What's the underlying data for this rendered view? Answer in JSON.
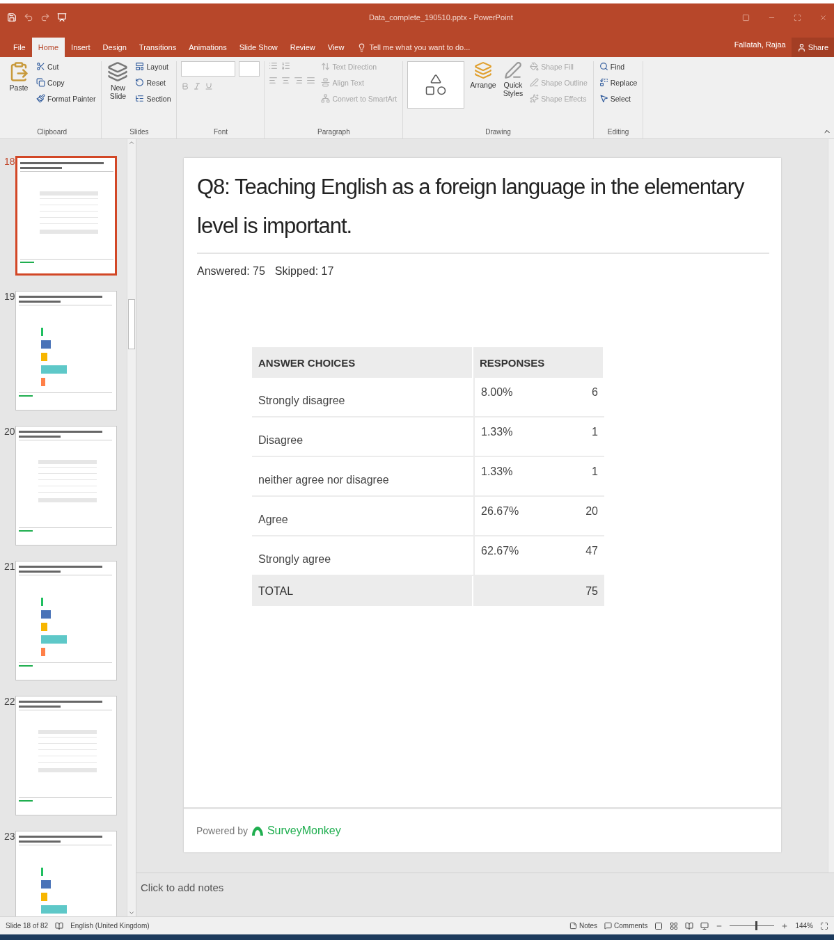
{
  "window": {
    "title": "Data_complete_190510.pptx - PowerPoint"
  },
  "tabs": [
    {
      "label": "File",
      "selected": false
    },
    {
      "label": "Home",
      "selected": true
    },
    {
      "label": "Insert",
      "selected": false
    },
    {
      "label": "Design",
      "selected": false
    },
    {
      "label": "Transitions",
      "selected": false
    },
    {
      "label": "Animations",
      "selected": false
    },
    {
      "label": "Slide Show",
      "selected": false
    },
    {
      "label": "Review",
      "selected": false
    },
    {
      "label": "View",
      "selected": false
    }
  ],
  "tell_me": {
    "placeholder": "Tell me what you want to do..."
  },
  "user": "Fallatah, Rajaa",
  "share": "Share",
  "ribbon": {
    "clipboard": {
      "label": "Clipboard",
      "paste": "Paste",
      "items": [
        {
          "label": "Cut",
          "disabled": false
        },
        {
          "label": "Copy",
          "disabled": false
        },
        {
          "label": "Format Painter",
          "disabled": false
        }
      ]
    },
    "slides": {
      "label": "Slides",
      "new_slide": [
        "New",
        "Slide"
      ],
      "items": [
        {
          "label": "Layout",
          "disabled": false
        },
        {
          "label": "Reset",
          "disabled": false
        },
        {
          "label": "Section",
          "disabled": false
        }
      ]
    },
    "font": {
      "label": "Font"
    },
    "paragraph": {
      "label": "Paragraph",
      "items": [
        {
          "label": "Text Direction",
          "disabled": true
        },
        {
          "label": "Align Text",
          "disabled": true
        },
        {
          "label": "Convert to SmartArt",
          "disabled": true
        }
      ]
    },
    "drawing": {
      "label": "Drawing",
      "arrange": "Arrange",
      "quick_styles": [
        "Quick",
        "Styles"
      ],
      "items": [
        {
          "label": "Shape Fill",
          "disabled": true
        },
        {
          "label": "Shape Outline",
          "disabled": true
        },
        {
          "label": "Shape Effects",
          "disabled": true
        }
      ]
    },
    "editing": {
      "label": "Editing",
      "items": [
        {
          "label": "Find",
          "disabled": false
        },
        {
          "label": "Replace",
          "disabled": false
        },
        {
          "label": "Select",
          "disabled": false
        }
      ]
    }
  },
  "thumbnails": [
    {
      "number": "18",
      "selected": true,
      "kind": "table"
    },
    {
      "number": "19",
      "selected": false,
      "kind": "bar"
    },
    {
      "number": "20",
      "selected": false,
      "kind": "table"
    },
    {
      "number": "21",
      "selected": false,
      "kind": "bar"
    },
    {
      "number": "22",
      "selected": false,
      "kind": "table"
    },
    {
      "number": "23",
      "selected": false,
      "kind": "bar"
    }
  ],
  "slide": {
    "title": "Q8: Teaching English as a foreign language in the elementary level is important.",
    "answered": "Answered: 75",
    "skipped": "Skipped: 17",
    "table": {
      "columns": [
        "ANSWER CHOICES",
        "RESPONSES"
      ],
      "rows": [
        {
          "choice": "Strongly disagree",
          "percent": "8.00%",
          "count": "6"
        },
        {
          "choice": "Disagree",
          "percent": "1.33%",
          "count": "1"
        },
        {
          "choice": "neither agree nor disagree",
          "percent": "1.33%",
          "count": "1"
        },
        {
          "choice": "Agree",
          "percent": "26.67%",
          "count": "20"
        },
        {
          "choice": "Strongly agree",
          "percent": "62.67%",
          "count": "47"
        }
      ],
      "total": {
        "label": "TOTAL",
        "count": "75"
      }
    },
    "footer": {
      "powered_by": "Powered by",
      "brand": "SurveyMonkey"
    }
  },
  "notes": {
    "placeholder": "Click to add notes"
  },
  "status_bar": {
    "slide": "Slide 18 of 82",
    "language": "English (United Kingdom)",
    "notes": "Notes",
    "comments": "Comments",
    "zoom": "144%",
    "zoom_slider": {
      "level": 0.58
    }
  }
}
